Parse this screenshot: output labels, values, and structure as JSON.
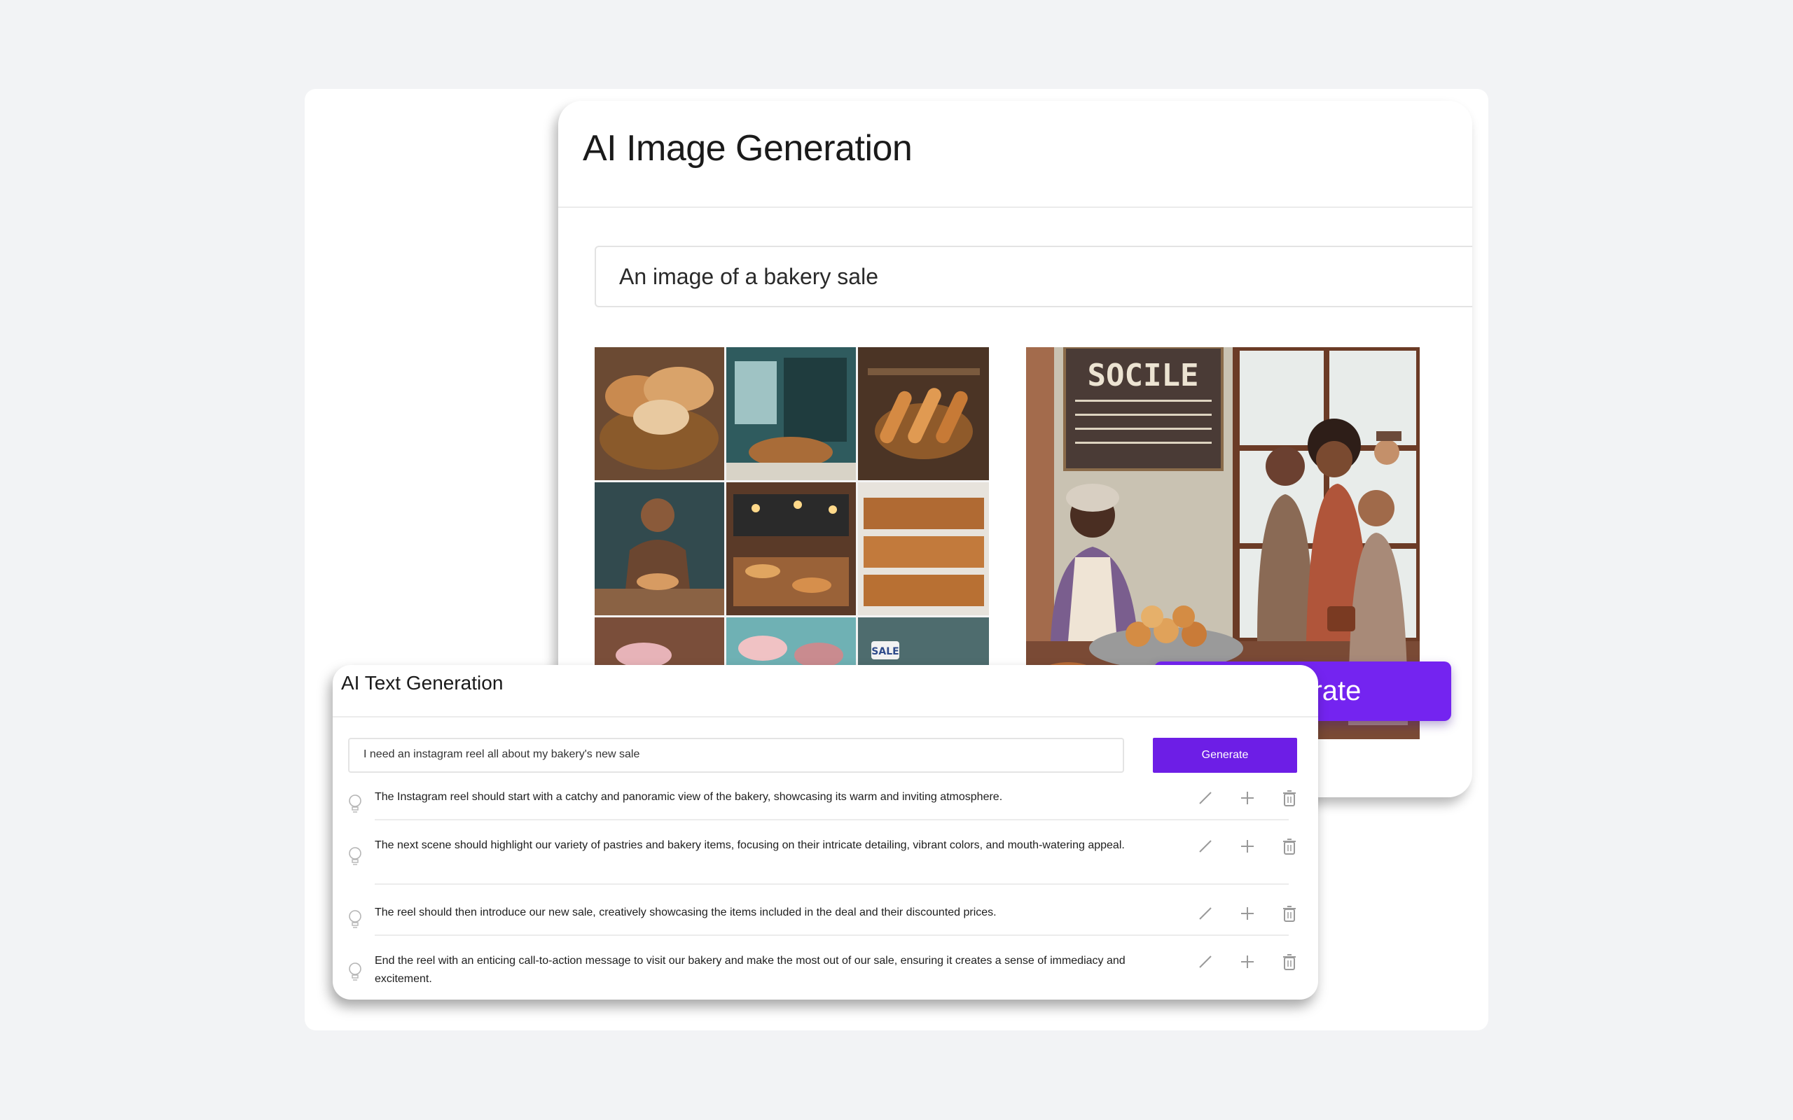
{
  "image_generation": {
    "title": "AI Image Generation",
    "prompt": "An image of a bakery sale",
    "images": [
      "bakery-collage",
      "bakery-sale-scene"
    ],
    "scene_sign_text": "SOCILE",
    "sale_tag_text": "SALE"
  },
  "callout": {
    "label": "Generate"
  },
  "text_generation": {
    "title": "AI Text Generation",
    "input_value": "I need an instagram reel all about my bakery's new sale",
    "generate_label": "Generate",
    "results": [
      {
        "text": "The Instagram reel should start with a catchy and panoramic view of the bakery, showcasing its warm and inviting atmosphere."
      },
      {
        "text": "The next scene should highlight our variety of pastries and bakery items, focusing on their intricate detailing, vibrant colors, and mouth-watering appeal."
      },
      {
        "text": "The reel should then introduce our new sale, creatively showcasing the items included in the deal and their discounted prices."
      },
      {
        "text": "End the reel with an enticing call-to-action message to visit our bakery and make the most out of our sale, ensuring it creates a sense of immediacy and excitement."
      }
    ],
    "row_icons": [
      "lightbulb-icon",
      "pencil-icon",
      "plus-icon",
      "trash-icon"
    ]
  },
  "colors": {
    "accent": "#7424f0",
    "button": "#6d1ee6",
    "background": "#f2f3f5"
  }
}
